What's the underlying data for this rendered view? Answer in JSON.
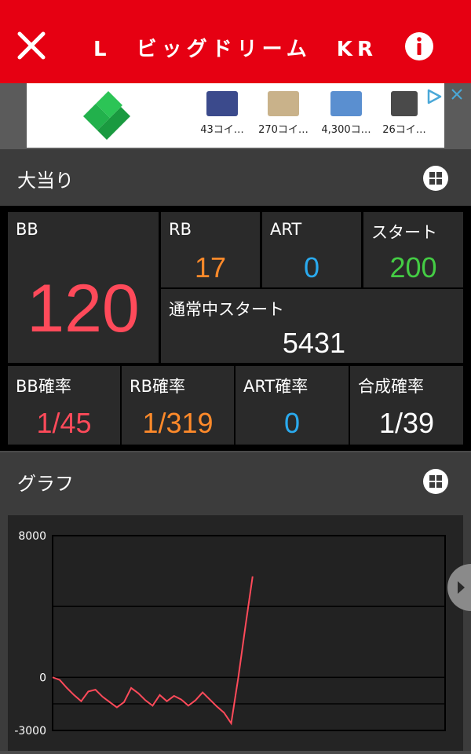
{
  "header": {
    "title": "L　ビッグドリーム　KR",
    "close_icon": "close-icon",
    "info_icon": "info-icon",
    "background": "#e60012"
  },
  "ad": {
    "items": [
      {
        "label": "43コイ…",
        "thumb_color": "#3b4a8c"
      },
      {
        "label": "270コイ…",
        "thumb_color": "#c9b28a"
      },
      {
        "label": "4,300コ…",
        "thumb_color": "#5a8fd0"
      },
      {
        "label": "26コイ…",
        "thumb_color": "#4a4a4a"
      }
    ],
    "logo_color": "#22b14c",
    "play_icon": "adchoices-icon",
    "close_icon": "close-icon"
  },
  "section_hits": {
    "title": "大当り"
  },
  "stats": {
    "bb": {
      "label": "BB",
      "value": "120",
      "color": "#ff4a5a"
    },
    "rb": {
      "label": "RB",
      "value": "17",
      "color": "#ff8a2a"
    },
    "art": {
      "label": "ART",
      "value": "0",
      "color": "#2aaaee"
    },
    "start": {
      "label": "スタート",
      "value": "200",
      "color": "#44cc44"
    },
    "normal_start": {
      "label": "通常中スタート",
      "value": "5431",
      "color": "#ffffff"
    },
    "bb_rate": {
      "label": "BB確率",
      "value": "1/45",
      "color": "#ff4a5a"
    },
    "rb_rate": {
      "label": "RB確率",
      "value": "1/319",
      "color": "#ff8a2a"
    },
    "art_rate": {
      "label": "ART確率",
      "value": "0",
      "color": "#2aaaee"
    },
    "total_rate": {
      "label": "合成確率",
      "value": "1/39",
      "color": "#ffffff"
    }
  },
  "section_graph": {
    "title": "グラフ"
  },
  "chart_data": {
    "type": "line",
    "ylim": [
      -3000,
      8000
    ],
    "yticks": [
      "8000",
      "0",
      "-3000"
    ],
    "grid": true,
    "line_color": "#ff4a5a",
    "y": [
      0,
      -150,
      -600,
      -1000,
      -1350,
      -800,
      -700,
      -1100,
      -1400,
      -1700,
      -1400,
      -600,
      -900,
      -1300,
      -1600,
      -1000,
      -1350,
      -1050,
      -1250,
      -1600,
      -1300,
      -850,
      -1250,
      -1650,
      -2000,
      -2600,
      0,
      2900,
      5700
    ]
  }
}
